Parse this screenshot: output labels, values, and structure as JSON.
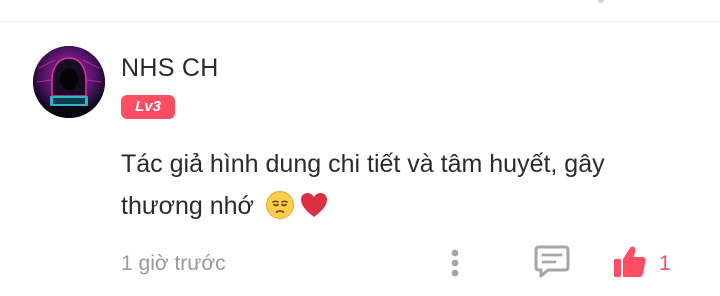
{
  "comment": {
    "user": {
      "name": "NHS CH",
      "level": "Lv3",
      "avatar": "hooded-figure-avatar"
    },
    "text": "Tác giả hình dung chi tiết và tâm huyết, gây thương nhớ",
    "emojis": [
      "pensive-face",
      "red-heart"
    ],
    "time": "1 giờ trước",
    "likes": "1"
  },
  "actions": {
    "more_icon": "vertical-dots-icon",
    "reply_icon": "comment-bubble-icon",
    "like_icon": "thumbs-up-icon"
  },
  "colors": {
    "accent": "#ff4d64",
    "text": "#2b2b2b",
    "muted": "#9a9a9a",
    "icon_gray": "#a6a6a6"
  }
}
